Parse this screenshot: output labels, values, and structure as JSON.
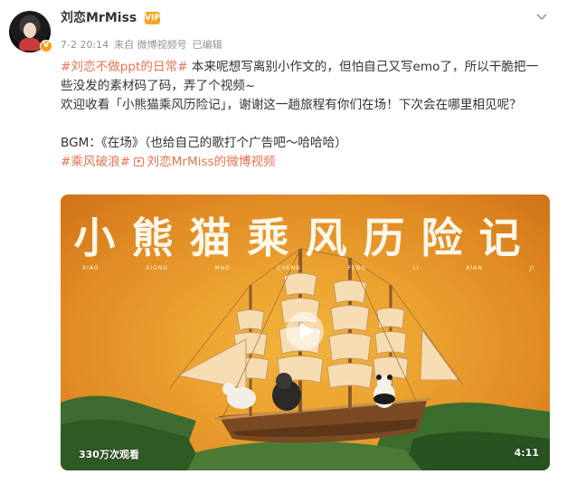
{
  "post": {
    "username": "刘恋MrMiss",
    "vip_badge": "VIP",
    "verified_badge": "V",
    "time": "7-2 20:14",
    "source": "来自 微博视频号",
    "edited": "已编辑",
    "line1_tag": "#刘恋不做ppt的日常#",
    "line1_text": " 本来呢想写离别小作文的，但怕自己又写emo了，所以干脆把一",
    "line2_text": "些没发的素材码了码，弄了个视频~",
    "line3_text": "欢迎收看「小熊猫乘风历险记」，谢谢这一趟旅程有你们在场！下次会在哪里相见呢？",
    "line4_text": "BGM：《在场》（也给自己的歌打个广告吧～哈哈哈）",
    "tag2": "#乘风破浪#",
    "video_link": "刘恋MrMiss的微博视频"
  },
  "video": {
    "title": "小熊猫乘风历险记",
    "pinyin": [
      "XIAO",
      "XIONG",
      "MAO",
      "CHENG",
      "FENG",
      "LI",
      "XIAN",
      "JI"
    ],
    "views": "330万次观看",
    "duration": "4:11"
  },
  "colors": {
    "accent": "#eb7350",
    "meta": "#939393",
    "video_bg": "#eba22f"
  },
  "icons": [
    "chevron-down-icon",
    "play-icon",
    "video-link-icon",
    "vip-icon",
    "verified-icon"
  ]
}
